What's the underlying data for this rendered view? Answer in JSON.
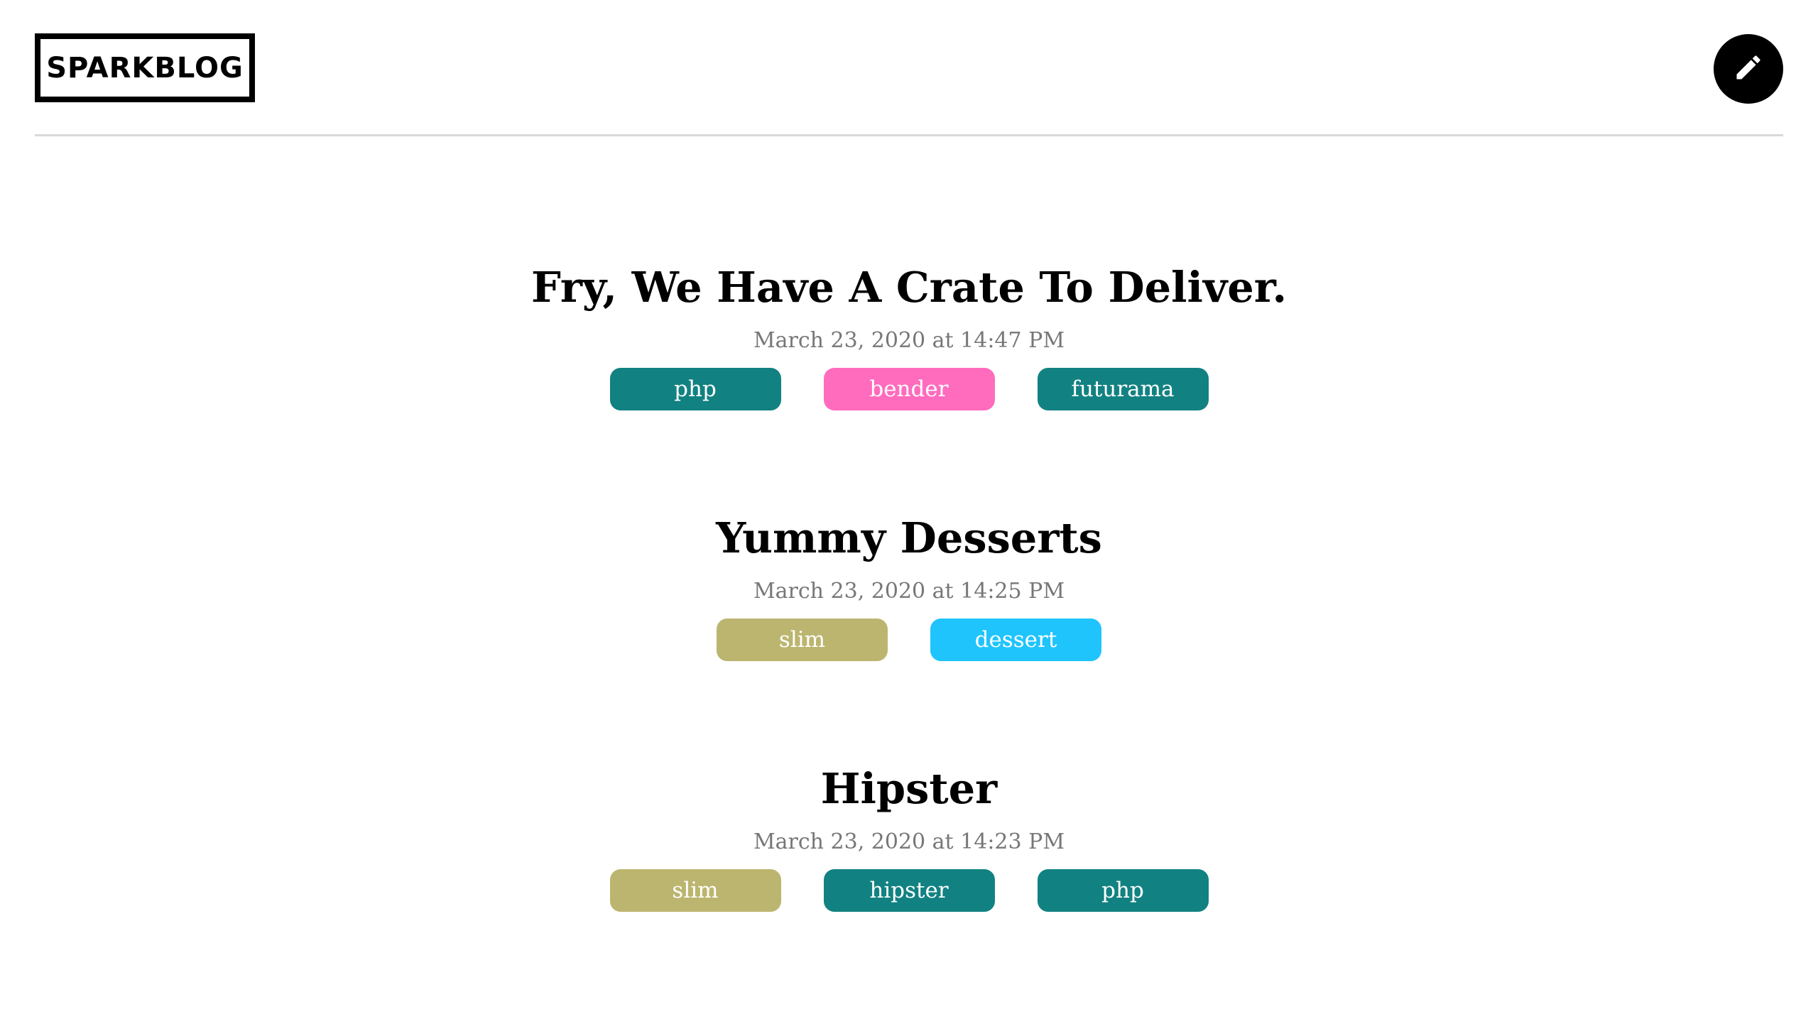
{
  "header": {
    "logo": "SPARKBLOG",
    "edit_icon": "pencil-icon"
  },
  "posts": [
    {
      "title": "Fry, We Have A Crate To Deliver.",
      "date": "March 23, 2020 at 14:47 PM",
      "tags": [
        {
          "label": "php",
          "color": "#128181"
        },
        {
          "label": "bender",
          "color": "#ff6bbd"
        },
        {
          "label": "futurama",
          "color": "#128181"
        }
      ]
    },
    {
      "title": "Yummy Desserts",
      "date": "March 23, 2020 at 14:25 PM",
      "tags": [
        {
          "label": "slim",
          "color": "#bcb56f"
        },
        {
          "label": "dessert",
          "color": "#1fc4fc"
        }
      ]
    },
    {
      "title": "Hipster",
      "date": "March 23, 2020 at 14:23 PM",
      "tags": [
        {
          "label": "slim",
          "color": "#bcb56f"
        },
        {
          "label": "hipster",
          "color": "#128181"
        },
        {
          "label": "php",
          "color": "#128181"
        }
      ]
    }
  ]
}
